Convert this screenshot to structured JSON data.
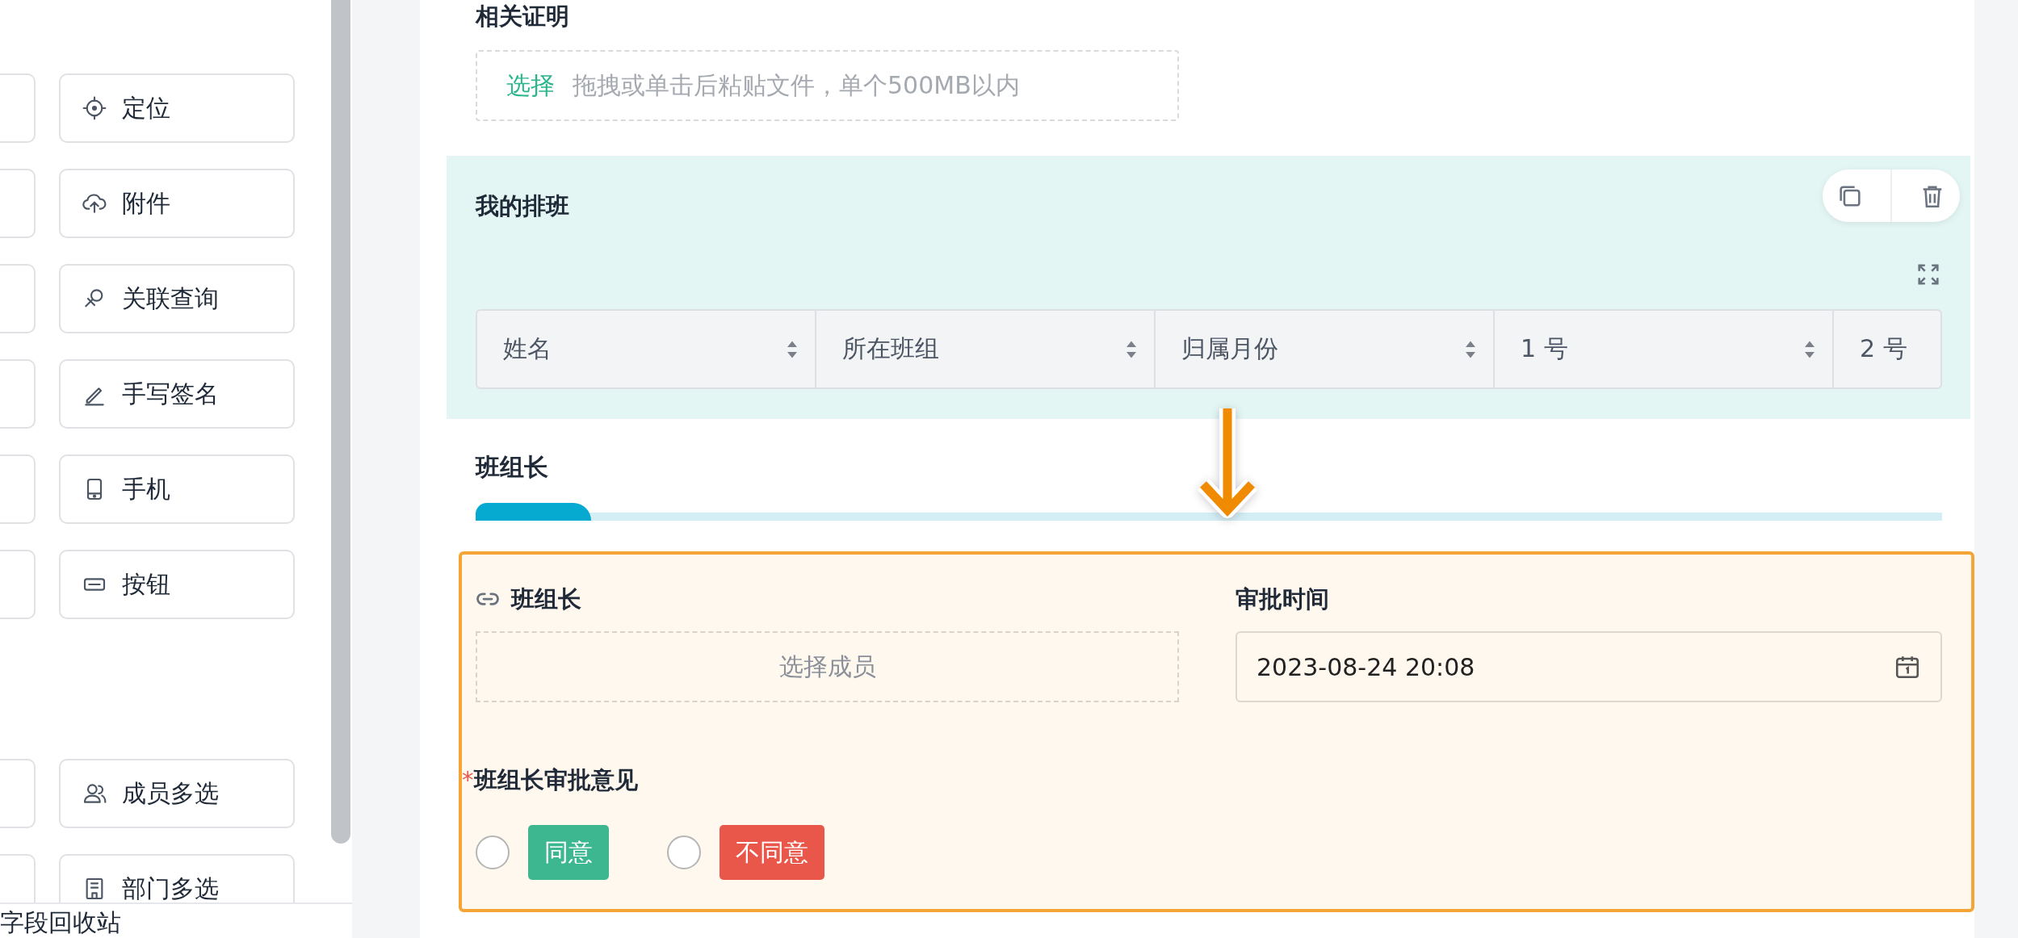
{
  "field_palette": {
    "groups": [
      {
        "items": [
          {
            "label": "定位"
          },
          {
            "label": "附件"
          },
          {
            "label": "关联查询"
          },
          {
            "label": "手写签名"
          },
          {
            "label": "手机"
          },
          {
            "label": "按钮"
          }
        ]
      },
      {
        "items": [
          {
            "label": "成员多选"
          },
          {
            "label": "部门多选"
          }
        ]
      }
    ],
    "recycle_bin": "字段回收站"
  },
  "upload_field": {
    "label": "相关证明",
    "action": "选择",
    "hint": "拖拽或单击后粘贴文件，单个500MB以内"
  },
  "subform": {
    "title": "我的排班",
    "columns": [
      {
        "label": "姓名",
        "sortable": true
      },
      {
        "label": "所在班组",
        "sortable": true
      },
      {
        "label": "归属月份",
        "sortable": true
      },
      {
        "label": "1 号",
        "sortable": true
      },
      {
        "label": "2 号",
        "sortable": false
      }
    ]
  },
  "section": {
    "title": "班组长"
  },
  "approval": {
    "selected": true,
    "leader_field": {
      "label": "班组长",
      "placeholder": "选择成员"
    },
    "time_field": {
      "label": "审批时间",
      "value": "2023-08-24 20:08"
    },
    "opinion": {
      "label": "班组长审批意见",
      "required_mark": "*",
      "options": [
        {
          "label": "同意",
          "color": "#3cb78f",
          "selected": false
        },
        {
          "label": "不同意",
          "color": "#e9574b",
          "selected": false
        }
      ]
    }
  }
}
